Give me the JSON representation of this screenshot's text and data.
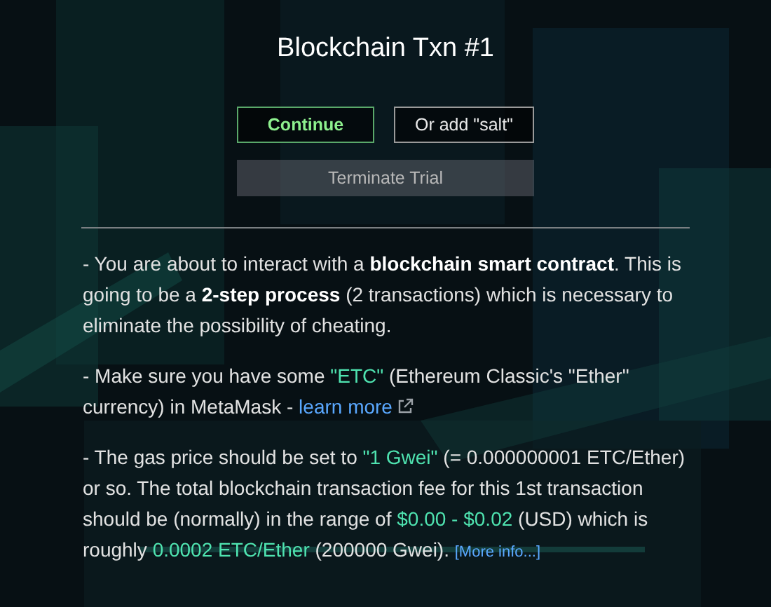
{
  "title": "Blockchain Txn #1",
  "buttons": [
    {
      "label": "Continue",
      "kind": "primary"
    },
    {
      "label": "Or add \"salt\"",
      "kind": "outline"
    }
  ],
  "terminate_button": {
    "label": "Terminate Trial"
  },
  "paragraphs": [
    [
      {
        "text": "- You are about to interact with a ",
        "kind": "plain"
      },
      {
        "text": "blockchain smart contract",
        "kind": "bold"
      },
      {
        "text": ". This is going to be a ",
        "kind": "plain"
      },
      {
        "text": "2-step process",
        "kind": "bold"
      },
      {
        "text": " (2 transactions) which is necessary to eliminate the possibility of cheating.",
        "kind": "plain"
      }
    ],
    [
      {
        "text": "- Make sure you have some ",
        "kind": "plain"
      },
      {
        "text": "\"ETC\"",
        "kind": "highlight"
      },
      {
        "text": " (Ethereum Classic's \"Ether\" currency) in MetaMask - ",
        "kind": "plain"
      },
      {
        "text": "learn more",
        "kind": "external-link"
      }
    ],
    [
      {
        "text": "- The gas price should be set to ",
        "kind": "plain"
      },
      {
        "text": "\"1 Gwei\"",
        "kind": "highlight"
      },
      {
        "text": " (= 0.000000001 ETC/Ether) or so. The total blockchain transaction fee for this 1st transaction should be (normally) in the range of ",
        "kind": "plain"
      },
      {
        "text": "$0.00 - $0.02",
        "kind": "highlight"
      },
      {
        "text": " (USD) which is roughly ",
        "kind": "plain"
      },
      {
        "text": "0.0002 ETC/Ether",
        "kind": "highlight"
      },
      {
        "text": " (200000 Gwei). ",
        "kind": "plain"
      },
      {
        "text": "[More info...]",
        "kind": "small-link"
      }
    ]
  ]
}
